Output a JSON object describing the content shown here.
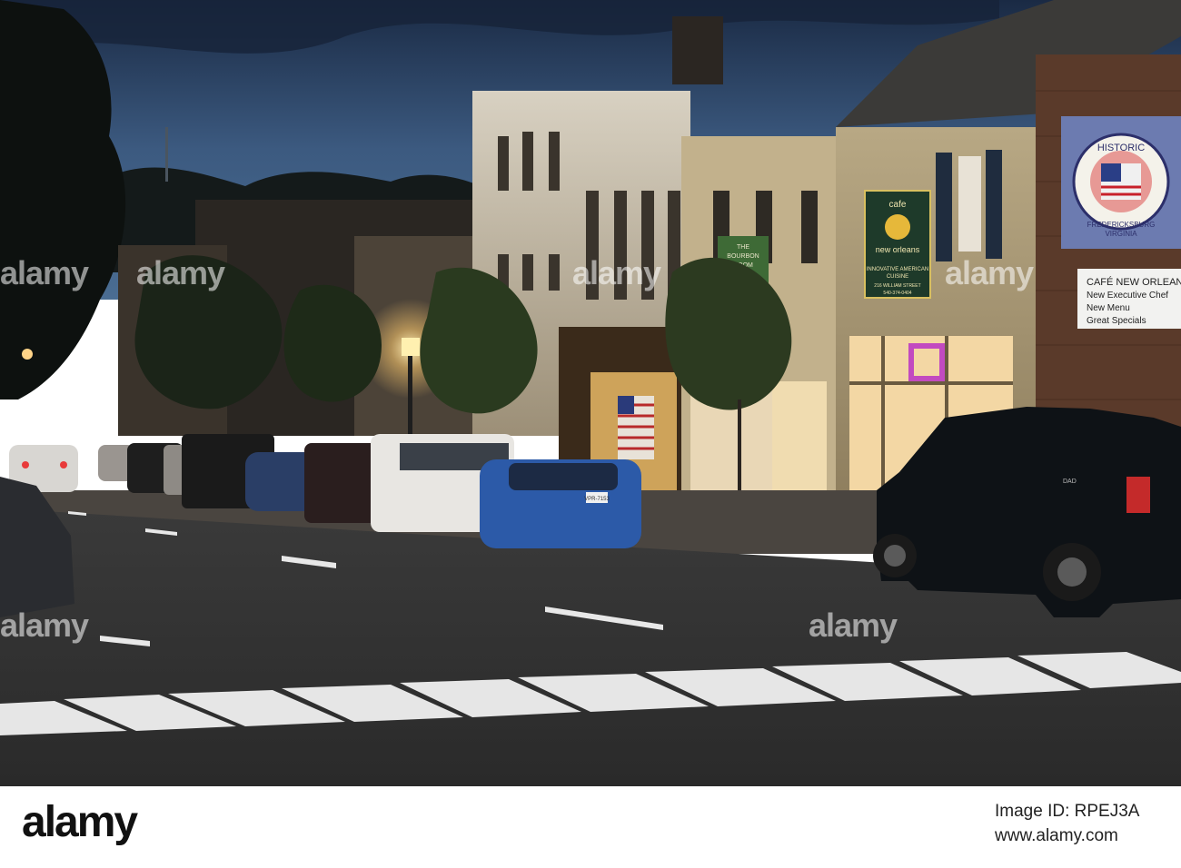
{
  "scene": {
    "description_colors": {
      "sky_top": "#1a2a44",
      "sky_mid": "#3c5a80",
      "street": "#3a3a3a",
      "warm_light": "#f3c26b"
    },
    "signs": {
      "cafe_sign_top": "cafe",
      "cafe_sign_name": "new orleans",
      "cafe_sign_tagline_1": "INNOVATIVE AMERICAN",
      "cafe_sign_tagline_2": "CUISINE",
      "cafe_sign_address": "216 WILLIAM STREET",
      "cafe_sign_phone": "540-374-0404",
      "historic_seal_top": "HISTORIC",
      "historic_seal_left": "FREDERICKSBURG",
      "historic_seal_right": "VIRGINIA",
      "banner_title": "CAFÉ NEW ORLEANS",
      "banner_line1": "New Executive Chef",
      "banner_line2": "New Menu",
      "banner_line3": "Great Specials",
      "bourbon_sign_1": "THE",
      "bourbon_sign_2": "BOURBON",
      "bourbon_sign_3": "ROOM",
      "license_plate": "VPR-7153",
      "truck_badge": "DAD"
    }
  },
  "watermarks": {
    "label": "alamy"
  },
  "footer": {
    "logo": "alamy",
    "image_id": "Image ID: RPEJ3A",
    "url": "www.alamy.com"
  }
}
